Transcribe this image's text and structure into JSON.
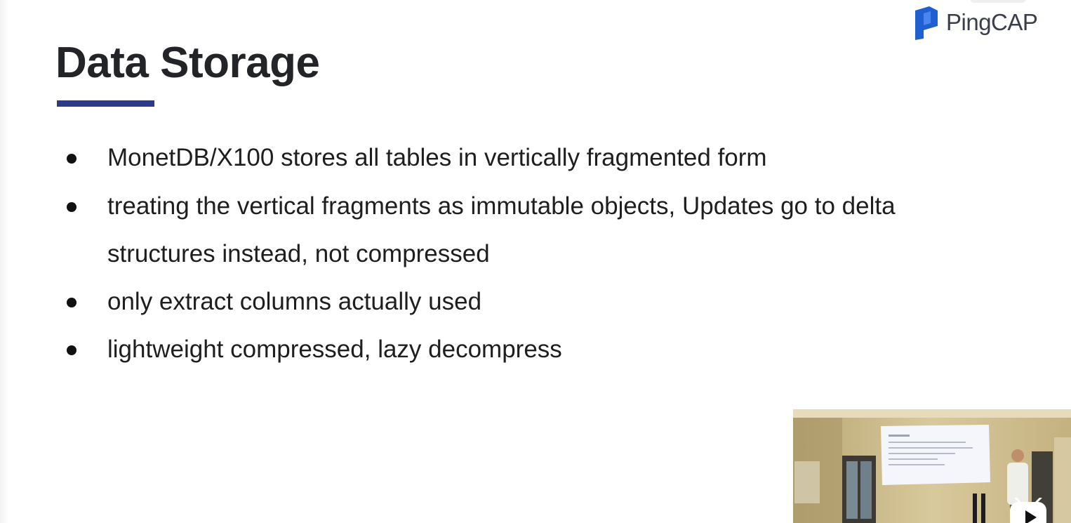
{
  "slide": {
    "title": "Data Storage",
    "logo_text": "PingCAP",
    "bullets": [
      "MonetDB/X100 stores all tables in vertically fragmented form",
      "treating the vertical fragments as immutable objects, Updates go to delta structures instead, not compressed",
      "only extract columns actually used",
      "lightweight compressed, lazy decompress"
    ]
  },
  "colors": {
    "title_underline": "#2d3a8c",
    "logo_mark": "#1f5fd1",
    "title_text": "#222428"
  },
  "icons": {
    "logo": "pingcap-logo-icon",
    "play": "play-icon"
  }
}
